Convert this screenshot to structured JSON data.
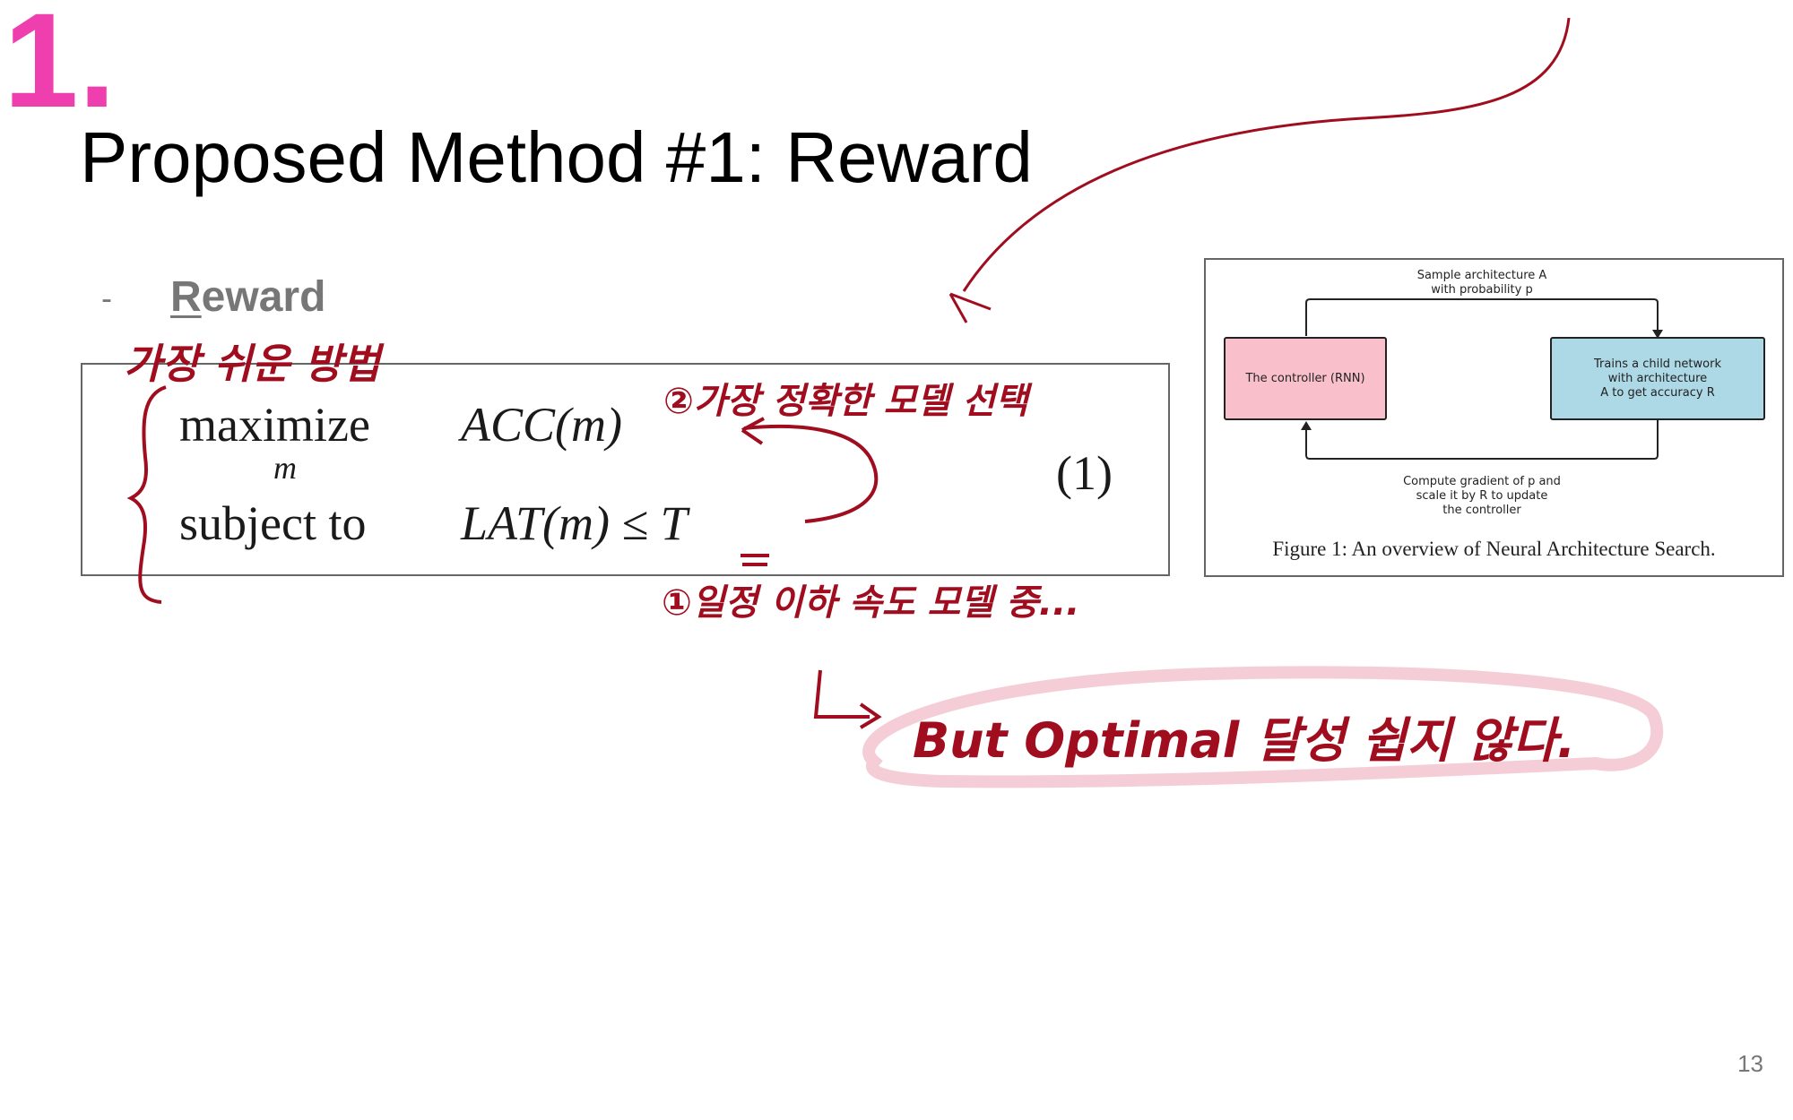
{
  "slide": {
    "title": "Proposed Method #1: Reward",
    "page_number": "13",
    "bullet": {
      "dash": "-",
      "label_first": "R",
      "label_rest": "eward"
    }
  },
  "equation": {
    "row1_keyword": "maximize",
    "row1_sub": "m",
    "row1_expr": "ACC(m)",
    "row2_keyword": "subject to",
    "row2_expr": "LAT(m) ≤ T",
    "number": "(1)"
  },
  "figure": {
    "caption": "Figure 1: An overview of Neural Architecture Search.",
    "top_label": "Sample architecture A\nwith probability p",
    "controller_label": "The controller (RNN)",
    "child_label": "Trains a child network\nwith architecture\nA to get accuracy R",
    "bottom_label": "Compute gradient of p and\nscale it by R to update\nthe controller",
    "controller_color": "#f9c0cb",
    "child_color": "#add8e6"
  },
  "annotations": {
    "number_mark": "1.",
    "easiest_method": "가장 쉬운 방법",
    "select_accurate": "②가장 정확한 모델 선택",
    "under_latency": "①일정 이하 속도 모델 중...",
    "but_optimal": "But Optimal 달성 쉽지 않다.",
    "ink_color": "#a00d1e",
    "highlight_color": "#ef3fae"
  }
}
